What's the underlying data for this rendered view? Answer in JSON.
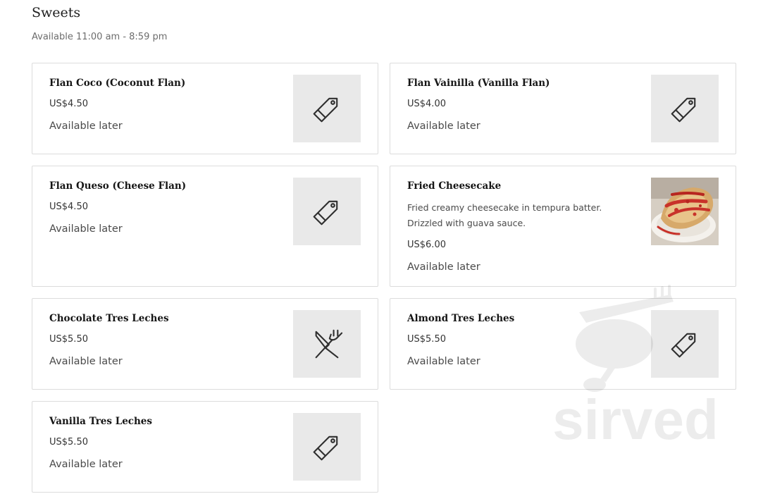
{
  "section": {
    "title": "Sweets",
    "hours": "Available 11:00 am - 8:59 pm"
  },
  "items": [
    {
      "name": "Flan Coco (Coconut Flan)",
      "price": "US$4.50",
      "availability": "Available later",
      "icon": "tag-icon"
    },
    {
      "name": "Flan Vainilla (Vanilla Flan)",
      "price": "US$4.00",
      "availability": "Available later",
      "icon": "tag-icon"
    },
    {
      "name": "Flan Queso (Cheese Flan)",
      "price": "US$4.50",
      "availability": "Available later",
      "icon": "tag-icon"
    },
    {
      "name": "Fried Cheesecake",
      "description": "Fried creamy cheesecake in tempura batter. Drizzled with guava sauce.",
      "price": "US$6.00",
      "availability": "Available later",
      "icon": "cheesecake-photo"
    },
    {
      "name": "Chocolate Tres Leches",
      "price": "US$5.50",
      "availability": "Available later",
      "icon": "fork-knife-icon"
    },
    {
      "name": "Almond Tres Leches",
      "price": "US$5.50",
      "availability": "Available later",
      "icon": "tag-icon"
    },
    {
      "name": "Vanilla Tres Leches",
      "price": "US$5.50",
      "availability": "Available later",
      "icon": "tag-icon"
    }
  ],
  "watermark": {
    "text": "sirved"
  },
  "colors": {
    "card_border": "#dcdcdc",
    "thumb_bg": "#e9e9e9",
    "icon_stroke": "#2f2f2f",
    "guava_sauce": "#c8322a"
  }
}
